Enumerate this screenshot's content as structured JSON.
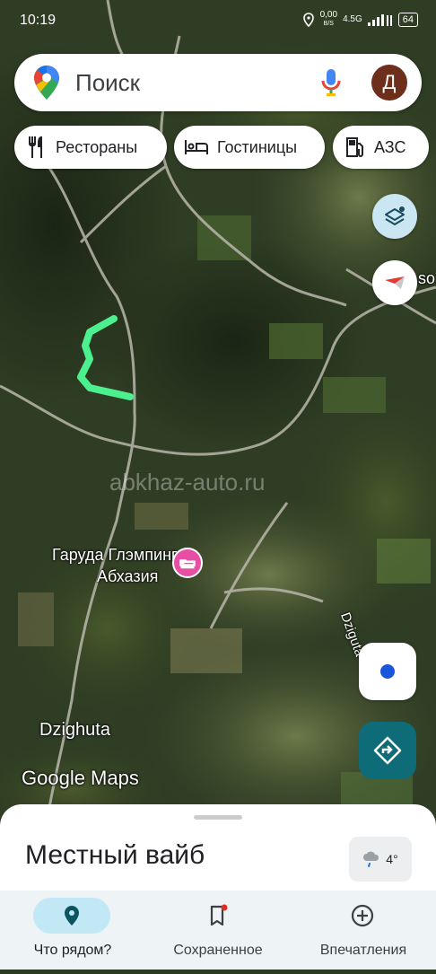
{
  "status_bar": {
    "time": "10:19",
    "data_speed": "0,00",
    "data_unit": "B/S",
    "network": "4.5G",
    "battery": "64"
  },
  "search": {
    "placeholder": "Поиск",
    "avatar_initial": "Д"
  },
  "chips": [
    {
      "label": "Рестораны",
      "icon": "restaurant-icon"
    },
    {
      "label": "Гостиницы",
      "icon": "hotel-icon"
    },
    {
      "label": "АЗС",
      "icon": "gas-station-icon"
    }
  ],
  "map": {
    "watermark": "abkhaz-auto.ru",
    "poi_name_line1": "Гаруда Глэмпинг",
    "poi_name_line2": "Абхазия",
    "place_label": "Dzighuta",
    "road_label": "Dziguta",
    "partial_label": "so",
    "google_logo": "Google Maps",
    "colors": {
      "route": "#4cf08f",
      "poi": "#e84fa4",
      "navigate": "#0e6b78",
      "location_dot": "#1a56db"
    }
  },
  "sheet": {
    "title": "Местный вайб",
    "weather": "4°"
  },
  "nav": [
    {
      "label": "Что рядом?",
      "icon": "location-pin-icon",
      "active": true
    },
    {
      "label": "Сохраненное",
      "icon": "bookmark-icon",
      "active": false
    },
    {
      "label": "Впечатления",
      "icon": "add-circle-icon",
      "active": false
    }
  ]
}
